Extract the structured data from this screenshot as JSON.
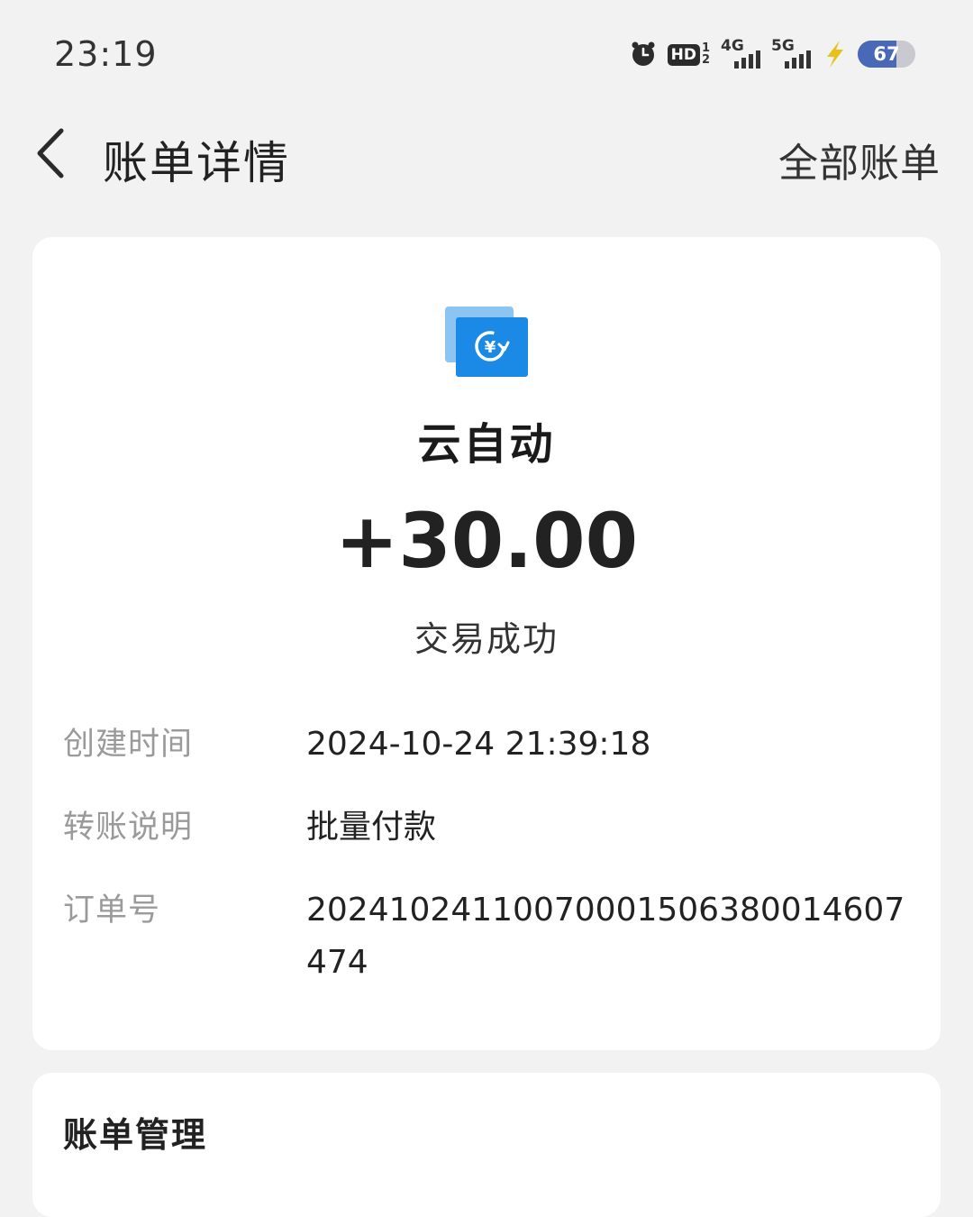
{
  "status_bar": {
    "time": "23:19",
    "hd_label": "HD",
    "hd_sub_top": "1",
    "hd_sub_bottom": "2",
    "signal_1": "4G",
    "signal_2": "5G",
    "battery_level": "67",
    "battery_fraction": 0.67,
    "battery_color": "#4a68b8"
  },
  "nav": {
    "back_icon": "chevron-left-icon",
    "title": "账单详情",
    "all_bills": "全部账单"
  },
  "detail": {
    "merchant_icon": "yuan-refund-icon",
    "icon_color": "#1a8ae6",
    "merchant_name": "云自动",
    "amount": "+30.00",
    "status": "交易成功",
    "rows": [
      {
        "label": "创建时间",
        "value": "2024-10-24 21:39:18"
      },
      {
        "label": "转账说明",
        "value": "批量付款"
      },
      {
        "label": "订单号",
        "value": "20241024110070001506380014607474"
      }
    ]
  },
  "manage": {
    "title": "账单管理"
  }
}
